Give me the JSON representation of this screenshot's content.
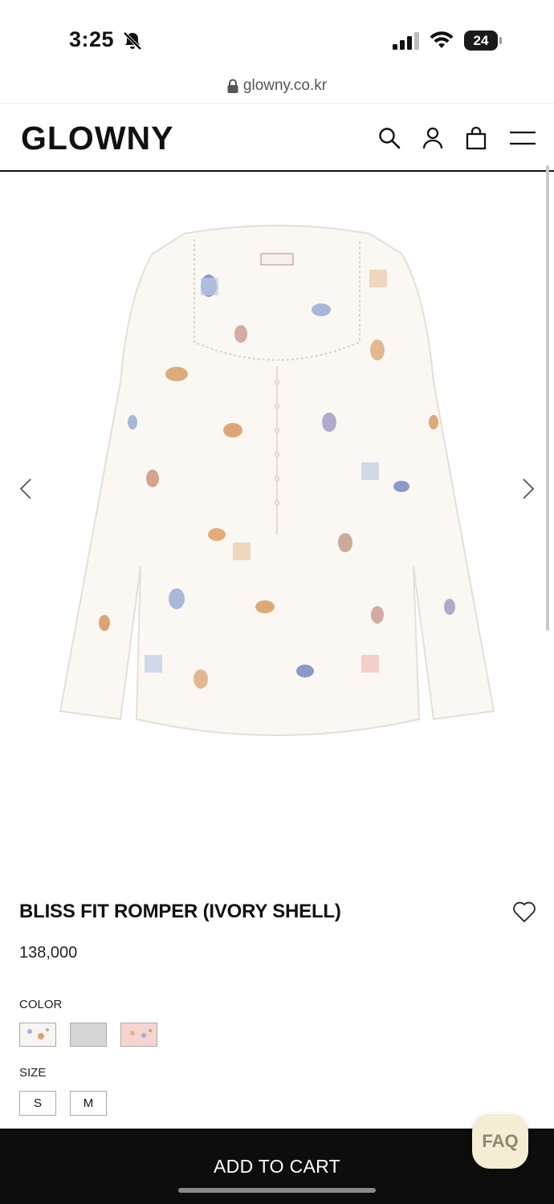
{
  "status_bar": {
    "time": "3:25",
    "battery": "24"
  },
  "browser": {
    "url": "glowny.co.kr"
  },
  "header": {
    "logo": "GLOWNY"
  },
  "product": {
    "name": "BLISS FIT ROMPER (IVORY SHELL)",
    "price": "138,000",
    "color_label": "COLOR",
    "size_label": "SIZE",
    "swatch_colors": [
      "#f7f5f2",
      "#d6d6d6",
      "#f6d5d0"
    ],
    "sizes": [
      "S",
      "M"
    ]
  },
  "actions": {
    "add_to_cart": "ADD TO CART",
    "faq": "FAQ"
  },
  "colors": {
    "accent": "#0d0d0d",
    "faq_bg": "#f4ecd3"
  }
}
